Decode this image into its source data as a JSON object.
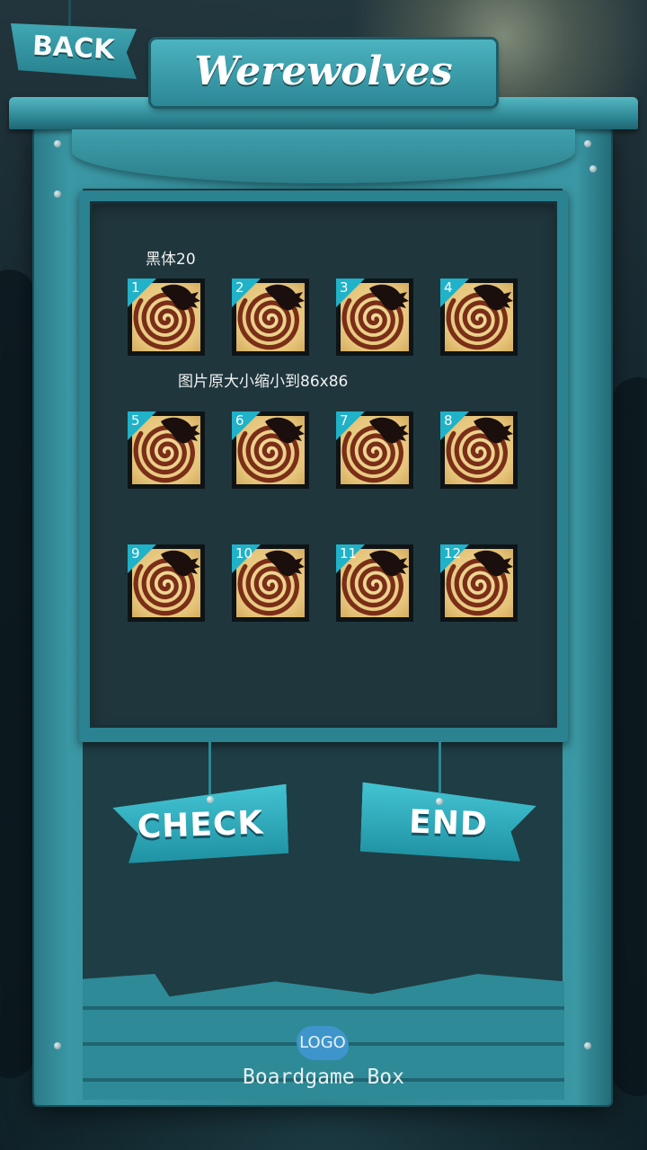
{
  "header": {
    "back_label": "BACK",
    "title": "Werewolves"
  },
  "notes": {
    "font_note": "黑体20",
    "size_note": "图片原大小缩小到86x86"
  },
  "cards": [
    {
      "number": "1"
    },
    {
      "number": "2"
    },
    {
      "number": "3"
    },
    {
      "number": "4"
    },
    {
      "number": "5"
    },
    {
      "number": "6"
    },
    {
      "number": "7"
    },
    {
      "number": "8"
    },
    {
      "number": "9"
    },
    {
      "number": "10"
    },
    {
      "number": "11"
    },
    {
      "number": "12"
    }
  ],
  "actions": {
    "check_label": "CHECK",
    "end_label": "END"
  },
  "footer": {
    "logo_label": "LOGO",
    "brand": "Boardgame Box"
  },
  "colors": {
    "accent": "#2f8592",
    "badge": "#1fb2c9",
    "panel": "#1f363d",
    "card_face": "#e6c57b"
  },
  "icons": {
    "card_art": "spiral-claw-icon"
  }
}
